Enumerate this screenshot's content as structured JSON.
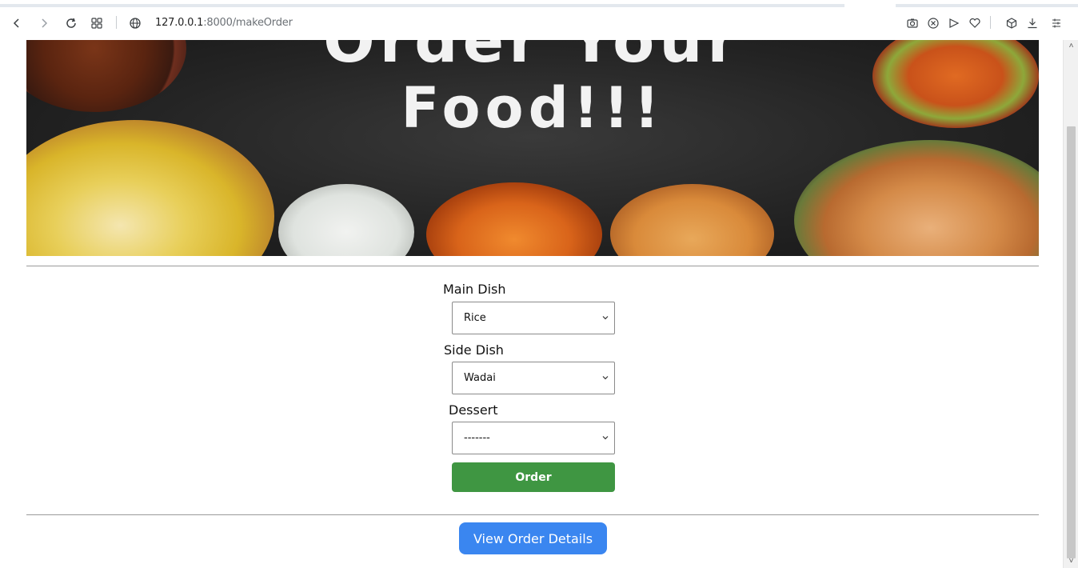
{
  "browser": {
    "url_host": "127.0.0.1",
    "url_path": ":8000/makeOrder",
    "toolbar_icons": [
      "back-icon",
      "forward-icon",
      "reload-icon",
      "apps-grid-icon",
      "globe-icon",
      "screenshot-icon",
      "close-circle-icon",
      "send-icon",
      "heart-icon",
      "cube-icon",
      "download-icon",
      "menu-icon"
    ]
  },
  "banner": {
    "title_line1": "Order Your",
    "title_line2": "Food!!!"
  },
  "form": {
    "main_dish_label": "Main Dish",
    "main_dish_value": "Rice",
    "side_dish_label": "Side Dish",
    "side_dish_value": "Wadai",
    "dessert_label": "Dessert",
    "dessert_value": "-------",
    "order_button": "Order"
  },
  "footer": {
    "view_button": "View Order Details"
  },
  "colors": {
    "order_button": "#3f9642",
    "view_button": "#3a86f0",
    "banner_bg": "#242424"
  }
}
